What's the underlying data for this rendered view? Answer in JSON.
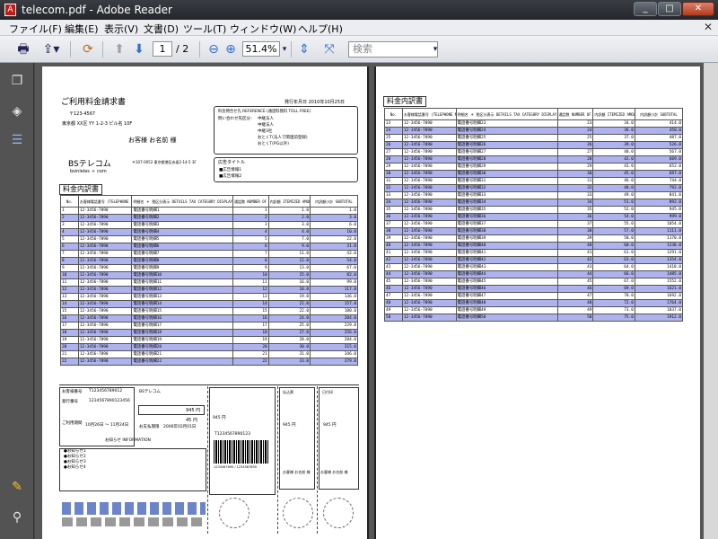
{
  "window": {
    "title": "telecom.pdf - Adobe Reader",
    "app_icon": "adobe-reader-icon"
  },
  "menu": [
    "ファイル(F)",
    "編集(E)",
    "表示(V)",
    "文書(D)",
    "ツール(T)",
    "ウィンドウ(W)",
    "ヘルプ(H)"
  ],
  "toolbar": {
    "page_current": "1",
    "page_total": "/ 2",
    "zoom": "51.4%",
    "search_placeholder": "検索"
  },
  "doc": {
    "p1_title": "ご利用料金請求書",
    "issue_date": "発行年月日 2010年10月25日",
    "postal": "〒123-4567",
    "address": "東京都 XX区 YY 1-2-3 ビル名 10F",
    "customer": "お客様 お名前 様",
    "inquiry_header": "料金問合せ先 REFERENCE (通話料無料 TOLL FREE)",
    "inquiry_sub": "問い合わせ先区分：",
    "inquiry_items": [
      "中継法人",
      "中継法人",
      "中継3社",
      "おとくT(法人で関連前登録)",
      "おとくT(PG以外)"
    ],
    "company": "BSテレコム",
    "company_sub": "bsinleles ＋ com",
    "company_addr": "〒107-0052 東京都港区赤坂2-14-5 3F",
    "ad_title": "広告タイトル",
    "ad_items": [
      "■広告情報1",
      "■広告情報2"
    ],
    "section": "料金内訳書",
    "col_headers": [
      "No.",
      "お客様電話番号 (TELEPHONE NO.)",
      "明細名 ＊ 税区分表示 DETAILS TAX CATEGORY DISPLAY",
      "通話数 NUMBER OF CALLS",
      "内訳額 ITEMIZED AMOUNT",
      "内訳額小計 SUBTOTAL"
    ],
    "slip": {
      "customer_no_label": "お客様番号",
      "customer_no": "T123456789012",
      "issue_no_label": "発行番号",
      "issue_no": "1234567890123456",
      "period_label": "ご利用期間",
      "period": "10月26日 ～ 11月24日",
      "notice_label": "お知らせ INFORMATION",
      "notice_items": [
        "●お知らせ1",
        "●お知らせ2",
        "●お知らせ3",
        "●お知らせ4"
      ],
      "company": "BSテレコム",
      "amount": "945 円",
      "amount2": "45 円",
      "due_label": "お支払期限",
      "due": "2006年02月01日",
      "barcode_no": "T1234567890123",
      "barcode_digits": "1234567890 / 1234567890",
      "stamp_label": "日付印",
      "bank_label": "払込票",
      "customer_sig": "お客様 お名前 様"
    }
  },
  "rows": [
    {
      "no": "1",
      "tel": "12-3456-7890",
      "desc": "電話番号明細1",
      "calls": "1",
      "amt": "1.0",
      "sub": "1.0",
      "hl": false
    },
    {
      "no": "2",
      "tel": "12-3456-7890",
      "desc": "電話番号明細2",
      "calls": "2",
      "amt": "2.0",
      "sub": "3.0",
      "hl": true
    },
    {
      "no": "3",
      "tel": "12-3456-7890",
      "desc": "電話番号明細3",
      "calls": "3",
      "amt": "3.0",
      "sub": "6.0",
      "hl": false
    },
    {
      "no": "4",
      "tel": "12-3456-7890",
      "desc": "電話番号明細4",
      "calls": "4",
      "amt": "4.0",
      "sub": "10.0",
      "hl": true
    },
    {
      "no": "5",
      "tel": "12-3456-7890",
      "desc": "電話番号明細5",
      "calls": "5",
      "amt": "7.0",
      "sub": "22.0",
      "hl": false
    },
    {
      "no": "6",
      "tel": "12-3456-7890",
      "desc": "電話番号明細6",
      "calls": "6",
      "amt": "9.0",
      "sub": "31.0",
      "hl": true
    },
    {
      "no": "7",
      "tel": "12-3456-7890",
      "desc": "電話番号明細7",
      "calls": "7",
      "amt": "11.0",
      "sub": "42.0",
      "hl": false
    },
    {
      "no": "8",
      "tel": "12-3456-7890",
      "desc": "電話番号明細8",
      "calls": "8",
      "amt": "12.0",
      "sub": "54.0",
      "hl": true
    },
    {
      "no": "9",
      "tel": "12-3456-7890",
      "desc": "電話番号明細9",
      "calls": "9",
      "amt": "13.0",
      "sub": "67.0",
      "hl": false
    },
    {
      "no": "10",
      "tel": "12-3456-7890",
      "desc": "電話番号明細10",
      "calls": "10",
      "amt": "15.0",
      "sub": "82.0",
      "hl": true
    },
    {
      "no": "11",
      "tel": "12-3456-7890",
      "desc": "電話番号明細11",
      "calls": "11",
      "amt": "16.0",
      "sub": "99.0",
      "hl": false
    },
    {
      "no": "12",
      "tel": "12-3456-7890",
      "desc": "電話番号明細12",
      "calls": "12",
      "amt": "18.0",
      "sub": "117.0",
      "hl": true
    },
    {
      "no": "13",
      "tel": "12-3456-7890",
      "desc": "電話番号明細13",
      "calls": "13",
      "amt": "19.0",
      "sub": "136.0",
      "hl": false
    },
    {
      "no": "14",
      "tel": "12-3456-7890",
      "desc": "電話番号明細14",
      "calls": "14",
      "amt": "21.0",
      "sub": "157.0",
      "hl": true
    },
    {
      "no": "15",
      "tel": "12-3456-7890",
      "desc": "電話番号明細15",
      "calls": "15",
      "amt": "22.0",
      "sub": "180.0",
      "hl": false
    },
    {
      "no": "16",
      "tel": "12-3456-7890",
      "desc": "電話番号明細16",
      "calls": "16",
      "amt": "24.0",
      "sub": "204.0",
      "hl": true
    },
    {
      "no": "17",
      "tel": "12-3456-7890",
      "desc": "電話番号明細17",
      "calls": "17",
      "amt": "25.0",
      "sub": "229.0",
      "hl": false
    },
    {
      "no": "18",
      "tel": "12-3456-7890",
      "desc": "電話番号明細18",
      "calls": "18",
      "amt": "27.0",
      "sub": "256.0",
      "hl": true
    },
    {
      "no": "19",
      "tel": "12-3456-7890",
      "desc": "電話番号明細19",
      "calls": "19",
      "amt": "28.0",
      "sub": "284.0",
      "hl": false
    },
    {
      "no": "20",
      "tel": "12-3456-7890",
      "desc": "電話番号明細20",
      "calls": "20",
      "amt": "30.0",
      "sub": "315.0",
      "hl": true
    },
    {
      "no": "21",
      "tel": "12-3456-7890",
      "desc": "電話番号明細21",
      "calls": "21",
      "amt": "31.0",
      "sub": "346.0",
      "hl": false
    },
    {
      "no": "22",
      "tel": "12-3456-7890",
      "desc": "電話番号明細22",
      "calls": "22",
      "amt": "33.0",
      "sub": "379.0",
      "hl": true
    },
    {
      "no": "23",
      "tel": "12-3456-7890",
      "desc": "電話番号明細23",
      "calls": "23",
      "amt": "34.0",
      "sub": "414.0",
      "hl": false
    },
    {
      "no": "24",
      "tel": "12-3456-7890",
      "desc": "電話番号明細24",
      "calls": "24",
      "amt": "36.0",
      "sub": "450.0",
      "hl": true
    },
    {
      "no": "25",
      "tel": "12-3456-7890",
      "desc": "電話番号明細25",
      "calls": "25",
      "amt": "37.0",
      "sub": "487.0",
      "hl": false
    },
    {
      "no": "26",
      "tel": "12-3456-7890",
      "desc": "電話番号明細26",
      "calls": "26",
      "amt": "39.0",
      "sub": "526.0",
      "hl": true
    },
    {
      "no": "27",
      "tel": "12-3456-7890",
      "desc": "電話番号明細27",
      "calls": "27",
      "amt": "40.0",
      "sub": "567.0",
      "hl": false
    },
    {
      "no": "28",
      "tel": "12-3456-7890",
      "desc": "電話番号明細28",
      "calls": "28",
      "amt": "42.0",
      "sub": "609.0",
      "hl": true
    },
    {
      "no": "29",
      "tel": "12-3456-7890",
      "desc": "電話番号明細29",
      "calls": "29",
      "amt": "43.0",
      "sub": "652.0",
      "hl": false
    },
    {
      "no": "30",
      "tel": "12-3456-7890",
      "desc": "電話番号明細30",
      "calls": "30",
      "amt": "45.0",
      "sub": "697.0",
      "hl": true
    },
    {
      "no": "31",
      "tel": "12-3456-7890",
      "desc": "電話番号明細31",
      "calls": "31",
      "amt": "46.0",
      "sub": "744.0",
      "hl": false
    },
    {
      "no": "32",
      "tel": "12-3456-7890",
      "desc": "電話番号明細32",
      "calls": "32",
      "amt": "48.0",
      "sub": "792.0",
      "hl": true
    },
    {
      "no": "33",
      "tel": "12-3456-7890",
      "desc": "電話番号明細33",
      "calls": "33",
      "amt": "49.0",
      "sub": "841.0",
      "hl": false
    },
    {
      "no": "34",
      "tel": "12-3456-7890",
      "desc": "電話番号明細34",
      "calls": "34",
      "amt": "51.0",
      "sub": "892.0",
      "hl": true
    },
    {
      "no": "35",
      "tel": "12-3456-7890",
      "desc": "電話番号明細35",
      "calls": "35",
      "amt": "52.0",
      "sub": "945.0",
      "hl": false
    },
    {
      "no": "36",
      "tel": "12-3456-7890",
      "desc": "電話番号明細36",
      "calls": "36",
      "amt": "54.0",
      "sub": "999.0",
      "hl": true
    },
    {
      "no": "37",
      "tel": "12-3456-7890",
      "desc": "電話番号明細37",
      "calls": "37",
      "amt": "55.0",
      "sub": "1054.0",
      "hl": false
    },
    {
      "no": "38",
      "tel": "12-3456-7890",
      "desc": "電話番号明細38",
      "calls": "38",
      "amt": "57.0",
      "sub": "1111.0",
      "hl": true
    },
    {
      "no": "39",
      "tel": "12-3456-7890",
      "desc": "電話番号明細39",
      "calls": "39",
      "amt": "58.0",
      "sub": "1170.0",
      "hl": false
    },
    {
      "no": "40",
      "tel": "12-3456-7890",
      "desc": "電話番号明細40",
      "calls": "40",
      "amt": "60.0",
      "sub": "1230.0",
      "hl": true
    },
    {
      "no": "41",
      "tel": "12-3456-7890",
      "desc": "電話番号明細41",
      "calls": "41",
      "amt": "61.0",
      "sub": "1291.0",
      "hl": false
    },
    {
      "no": "42",
      "tel": "12-3456-7890",
      "desc": "電話番号明細42",
      "calls": "42",
      "amt": "63.0",
      "sub": "1354.0",
      "hl": true
    },
    {
      "no": "43",
      "tel": "12-3456-7890",
      "desc": "電話番号明細43",
      "calls": "43",
      "amt": "64.0",
      "sub": "1418.0",
      "hl": false
    },
    {
      "no": "44",
      "tel": "12-3456-7890",
      "desc": "電話番号明細44",
      "calls": "44",
      "amt": "66.0",
      "sub": "1485.0",
      "hl": true
    },
    {
      "no": "45",
      "tel": "12-3456-7890",
      "desc": "電話番号明細45",
      "calls": "45",
      "amt": "67.0",
      "sub": "1552.0",
      "hl": false
    },
    {
      "no": "46",
      "tel": "12-3456-7890",
      "desc": "電話番号明細46",
      "calls": "46",
      "amt": "69.0",
      "sub": "1621.0",
      "hl": true
    },
    {
      "no": "47",
      "tel": "12-3456-7890",
      "desc": "電話番号明細47",
      "calls": "47",
      "amt": "70.0",
      "sub": "1692.0",
      "hl": false
    },
    {
      "no": "48",
      "tel": "12-3456-7890",
      "desc": "電話番号明細48",
      "calls": "48",
      "amt": "72.0",
      "sub": "1764.0",
      "hl": true
    },
    {
      "no": "49",
      "tel": "12-3456-7890",
      "desc": "電話番号明細49",
      "calls": "49",
      "amt": "73.0",
      "sub": "1837.0",
      "hl": false
    },
    {
      "no": "50",
      "tel": "12-3456-7890",
      "desc": "電話番号明細50",
      "calls": "50",
      "amt": "75.0",
      "sub": "1912.0",
      "hl": true
    }
  ],
  "colors": {
    "row_highlight": "#aeb3ee",
    "titlebar": "#2b2f35",
    "viewer_bg": "#575757",
    "accent_red": "#c21b17"
  }
}
